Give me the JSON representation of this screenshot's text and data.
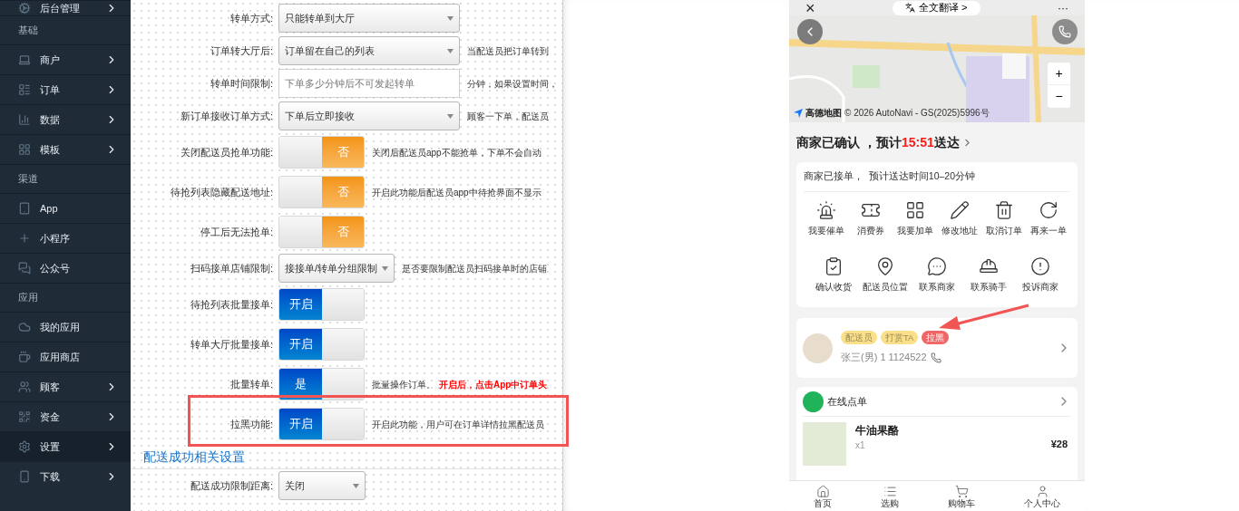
{
  "sidebar": {
    "items": [
      {
        "kind": "item",
        "label": "后台管理",
        "expandable": true,
        "selected": false
      },
      {
        "kind": "section",
        "label": "基础"
      },
      {
        "kind": "item",
        "label": "商户",
        "expandable": true,
        "selected": false
      },
      {
        "kind": "item",
        "label": "订单",
        "expandable": true,
        "selected": false
      },
      {
        "kind": "item",
        "label": "数据",
        "expandable": true,
        "selected": false
      },
      {
        "kind": "item",
        "label": "模板",
        "expandable": true,
        "selected": false
      },
      {
        "kind": "section",
        "label": "渠道"
      },
      {
        "kind": "item",
        "label": "App",
        "expandable": false,
        "selected": false
      },
      {
        "kind": "item",
        "label": "小程序",
        "expandable": false,
        "selected": false
      },
      {
        "kind": "item",
        "label": "公众号",
        "expandable": false,
        "selected": false
      },
      {
        "kind": "section",
        "label": "应用"
      },
      {
        "kind": "item",
        "label": "我的应用",
        "expandable": false,
        "selected": false
      },
      {
        "kind": "item",
        "label": "应用商店",
        "expandable": false,
        "selected": false
      },
      {
        "kind": "item",
        "label": "顾客",
        "expandable": true,
        "selected": false
      },
      {
        "kind": "item",
        "label": "资金",
        "expandable": true,
        "selected": false
      },
      {
        "kind": "item",
        "label": "设置",
        "expandable": true,
        "selected": true
      },
      {
        "kind": "item",
        "label": "下载",
        "expandable": true,
        "selected": false
      }
    ]
  },
  "form": {
    "rows": [
      {
        "kind": "select",
        "label": "转单方式:",
        "value": "只能转单到大厅"
      },
      {
        "kind": "select",
        "label": "订单转大厅后:",
        "value": "订单留在自己的列表",
        "note": "当配送员把订单转到"
      },
      {
        "kind": "input",
        "label": "转单时间限制:",
        "placeholder": "下单多少分钟后不可发起转单",
        "note": "分钟，如果设置时间，"
      },
      {
        "kind": "select",
        "label": "新订单接收订单方式:",
        "value": "下单后立即接收",
        "note": "顾客一下单，配送员"
      },
      {
        "kind": "toggle",
        "label": "关闭配送员抢单功能:",
        "on": false,
        "text": "否",
        "note": "关闭后配送员app不能抢单，下单不会自动"
      },
      {
        "kind": "toggle",
        "label": "待抢列表隐藏配送地址:",
        "on": false,
        "text": "否",
        "note": "开启此功能后配送员app中待抢界面不显示"
      },
      {
        "kind": "toggle",
        "label": "停工后无法抢单:",
        "on": false,
        "text": "否"
      },
      {
        "kind": "select",
        "label": "扫码接单店铺限制:",
        "value": "接接单/转单分组限制",
        "note": "是否要限制配送员扫码接单时的店铺"
      },
      {
        "kind": "toggle",
        "label": "待抢列表批量接单:",
        "on": true,
        "text": "开启"
      },
      {
        "kind": "toggle",
        "label": "转单大厅批量接单:",
        "on": true,
        "text": "开启"
      },
      {
        "kind": "toggle",
        "label": "批量转单:",
        "on": true,
        "text": "是",
        "note": "批量操作订单。",
        "warning": "开启后，点击App中订单头"
      },
      {
        "kind": "toggle",
        "label": "拉黑功能:",
        "on": true,
        "text": "开启",
        "note": "开启此功能，用户可在订单详情拉黑配送员"
      }
    ],
    "section_title": "配送成功相关设置",
    "rows_after": [
      {
        "kind": "select",
        "label": "配送成功限制距离:",
        "value": "关闭"
      }
    ]
  },
  "phone": {
    "top_bar": {
      "close": "×",
      "translate": "全文翻译 >",
      "more": "···"
    },
    "map": {
      "zoom_in": "+",
      "zoom_out": "−",
      "brand": "高德地图",
      "copyright": "© 2026 AutoNavi - GS(2025)5996号"
    },
    "status": {
      "prefix": "商家已确认 ，预计",
      "time": "15:51",
      "suffix": "送达"
    },
    "order_card": {
      "message": "商家已接单，  预计送达时间10–20分钟",
      "actions": [
        "我要催单",
        "消费券",
        "我要加单",
        "修改地址",
        "取消订单",
        "再来一单"
      ],
      "actions_2": [
        "确认收货",
        "配送员位置",
        "联系商家",
        "联系骑手",
        "投诉商家"
      ]
    },
    "rider": {
      "tags": [
        {
          "label": "配送员",
          "color": "#fbe08a"
        },
        {
          "label": "打赏TA",
          "color": "#fbe08a"
        },
        {
          "label": "拉黑",
          "color": "#f06666"
        }
      ],
      "name": "张三(男) 1 1124522"
    },
    "shop": {
      "title": "在线点单",
      "product": "牛油果酪",
      "quantity": "x1",
      "price": "¥28"
    },
    "tab_bar": [
      "首页",
      "选购",
      "购物车",
      "个人中心"
    ]
  }
}
